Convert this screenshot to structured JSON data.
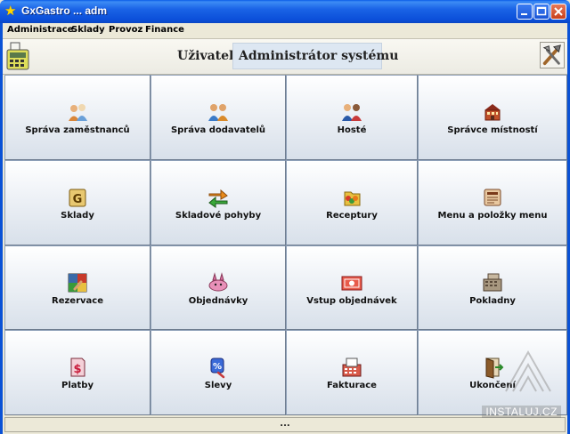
{
  "window": {
    "title": "GxGastro ... adm",
    "icon": "star-icon",
    "buttons": {
      "minimize": "minimize",
      "maximize": "maximize",
      "close": "close"
    }
  },
  "menubar": {
    "items": [
      "Administrace",
      "Sklady",
      "Provoz",
      "Finance"
    ]
  },
  "header": {
    "user_label": "Uživatel",
    "user_value": "Administrátor systému",
    "left_icon": "cash-register-icon",
    "right_icon": "tools-icon"
  },
  "tiles": [
    {
      "label": "Správa zaměstnanců",
      "icon": "employees-icon"
    },
    {
      "label": "Správa dodavatelů",
      "icon": "suppliers-icon"
    },
    {
      "label": "Hosté",
      "icon": "guests-icon"
    },
    {
      "label": "Správce místností",
      "icon": "rooms-icon"
    },
    {
      "label": "Sklady",
      "icon": "warehouse-icon"
    },
    {
      "label": "Skladové pohyby",
      "icon": "stock-movements-icon"
    },
    {
      "label": "Receptury",
      "icon": "recipes-icon"
    },
    {
      "label": "Menu a položky menu",
      "icon": "menu-icon"
    },
    {
      "label": "Rezervace",
      "icon": "reservations-icon"
    },
    {
      "label": "Objednávky",
      "icon": "orders-icon"
    },
    {
      "label": "Vstup objednávek",
      "icon": "order-entry-icon"
    },
    {
      "label": "Pokladny",
      "icon": "cash-registers-icon"
    },
    {
      "label": "Platby",
      "icon": "payments-icon"
    },
    {
      "label": "Slevy",
      "icon": "discounts-icon"
    },
    {
      "label": "Fakturace",
      "icon": "invoicing-icon"
    },
    {
      "label": "Ukončení",
      "icon": "exit-icon"
    }
  ],
  "statusbar": {
    "text": "..."
  },
  "watermark": {
    "text": "INSTALUJ.CZ"
  }
}
